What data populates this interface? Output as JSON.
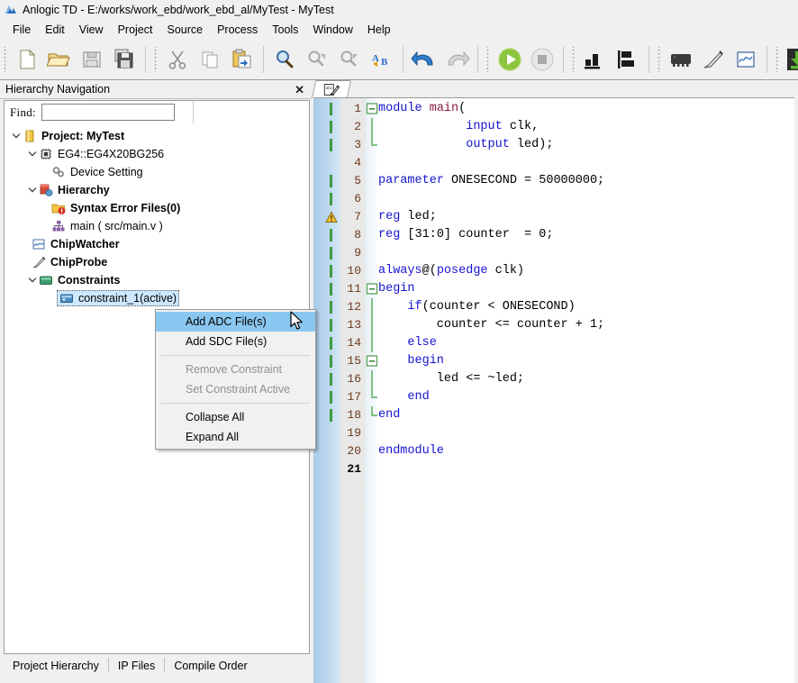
{
  "window": {
    "title": "Anlogic TD - E:/works/work_ebd/work_ebd_al/MyTest - MyTest",
    "app_icon": "anlogic-logo-icon"
  },
  "menubar": {
    "items": [
      {
        "label": "File",
        "name": "menu-file"
      },
      {
        "label": "Edit",
        "name": "menu-edit"
      },
      {
        "label": "View",
        "name": "menu-view"
      },
      {
        "label": "Project",
        "name": "menu-project"
      },
      {
        "label": "Source",
        "name": "menu-source"
      },
      {
        "label": "Process",
        "name": "menu-process"
      },
      {
        "label": "Tools",
        "name": "menu-tools"
      },
      {
        "label": "Window",
        "name": "menu-window"
      },
      {
        "label": "Help",
        "name": "menu-help"
      }
    ]
  },
  "toolbar": {
    "groups": [
      [
        "new-file-icon",
        "open-folder-icon",
        "save-icon",
        "save-all-icon"
      ],
      [
        "cut-icon",
        "copy-icon",
        "paste-icon"
      ],
      [
        "find-icon",
        "find-previous-icon",
        "find-next-icon",
        "replace-icon"
      ],
      [
        "undo-icon",
        "redo-icon"
      ],
      [
        "run-icon",
        "stop-icon"
      ],
      [
        "report-chart-icon",
        "layout-icon"
      ],
      [
        "device-chip-icon",
        "chipprobe-pen-icon",
        "chipwatcher-wave-icon"
      ],
      [
        "download-icon"
      ]
    ]
  },
  "hierarchy_panel": {
    "title": "Hierarchy Navigation",
    "close_icon": "close-icon",
    "find": {
      "label": "Find:",
      "value": "",
      "placeholder": ""
    },
    "tree": [
      {
        "label": "Project: MyTest",
        "icon": "project-folder-icon",
        "indent": 0,
        "twisty": "expanded",
        "bold": true,
        "selected": false
      },
      {
        "label": "EG4::EG4X20BG256",
        "icon": "device-chip-icon",
        "indent": 1,
        "twisty": "expanded",
        "bold": false,
        "selected": false
      },
      {
        "label": "Device Setting",
        "icon": "device-setting-icon",
        "indent": 2,
        "twisty": "none",
        "bold": false,
        "selected": false
      },
      {
        "label": "Hierarchy",
        "icon": "hierarchy-icon",
        "indent": 1,
        "twisty": "expanded",
        "bold": true,
        "selected": false
      },
      {
        "label": "Syntax Error Files(0)",
        "icon": "syntax-error-folder-icon",
        "indent": 2,
        "twisty": "none",
        "bold": true,
        "selected": false
      },
      {
        "label": "main ( src/main.v )",
        "icon": "module-tree-icon",
        "indent": 2,
        "twisty": "none",
        "bold": false,
        "selected": false
      },
      {
        "label": "ChipWatcher",
        "icon": "chipwatcher-wave-icon",
        "indent": 1,
        "twisty": "none",
        "bold": true,
        "selected": false
      },
      {
        "label": "ChipProbe",
        "icon": "chipprobe-pen-icon",
        "indent": 1,
        "twisty": "none",
        "bold": true,
        "selected": false
      },
      {
        "label": "Constraints",
        "icon": "constraints-icon",
        "indent": 1,
        "twisty": "expanded",
        "bold": true,
        "selected": false
      },
      {
        "label": "constraint_1(active)",
        "icon": "constraint-file-icon",
        "indent": 2,
        "twisty": "none",
        "bold": false,
        "selected": true
      }
    ],
    "bottom_tabs": [
      {
        "label": "Project Hierarchy",
        "active": true
      },
      {
        "label": "IP Files",
        "active": false
      },
      {
        "label": "Compile Order",
        "active": false
      }
    ]
  },
  "context_menu": {
    "items": [
      {
        "label": "Add ADC File(s)",
        "state": "highlighted"
      },
      {
        "label": "Add SDC File(s)",
        "state": "normal"
      },
      {
        "label": "__separator__",
        "state": "separator"
      },
      {
        "label": "Remove Constraint",
        "state": "disabled"
      },
      {
        "label": "Set Constraint Active",
        "state": "disabled"
      },
      {
        "label": "__separator__",
        "state": "separator"
      },
      {
        "label": "Collapse All",
        "state": "normal"
      },
      {
        "label": "Expand All",
        "state": "normal"
      }
    ]
  },
  "editor": {
    "tab_icon": "source-file-edit-icon",
    "current_line": 21,
    "lines": [
      {
        "num": "1",
        "changed": true,
        "warn": false,
        "fold": "open",
        "tokens": [
          {
            "t": "module",
            "c": "kw"
          },
          {
            "t": " ",
            "c": "pun"
          },
          {
            "t": "main",
            "c": "mod"
          },
          {
            "t": "(",
            "c": "pun"
          }
        ]
      },
      {
        "num": "2",
        "changed": true,
        "warn": false,
        "fold": "bar",
        "tokens": [
          {
            "t": "            ",
            "c": "pun"
          },
          {
            "t": "input",
            "c": "kw"
          },
          {
            "t": " clk,",
            "c": "pun"
          }
        ]
      },
      {
        "num": "3",
        "changed": true,
        "warn": false,
        "fold": "end",
        "tokens": [
          {
            "t": "            ",
            "c": "pun"
          },
          {
            "t": "output",
            "c": "kw"
          },
          {
            "t": " led);",
            "c": "pun"
          }
        ]
      },
      {
        "num": "4",
        "changed": false,
        "warn": false,
        "fold": "none",
        "tokens": []
      },
      {
        "num": "5",
        "changed": true,
        "warn": false,
        "fold": "none",
        "tokens": [
          {
            "t": "parameter",
            "c": "kw"
          },
          {
            "t": " ONESECOND = 50000000;",
            "c": "pun"
          }
        ]
      },
      {
        "num": "6",
        "changed": true,
        "warn": false,
        "fold": "none",
        "tokens": []
      },
      {
        "num": "7",
        "changed": false,
        "warn": true,
        "fold": "none",
        "tokens": [
          {
            "t": "reg",
            "c": "kw"
          },
          {
            "t": " led;",
            "c": "pun"
          }
        ]
      },
      {
        "num": "8",
        "changed": true,
        "warn": false,
        "fold": "none",
        "tokens": [
          {
            "t": "reg",
            "c": "kw"
          },
          {
            "t": " [31:0] counter  = 0;",
            "c": "pun"
          }
        ]
      },
      {
        "num": "9",
        "changed": true,
        "warn": false,
        "fold": "none",
        "tokens": []
      },
      {
        "num": "10",
        "changed": true,
        "warn": false,
        "fold": "none",
        "tokens": [
          {
            "t": "always",
            "c": "kw"
          },
          {
            "t": "@(",
            "c": "pun"
          },
          {
            "t": "posedge",
            "c": "kw"
          },
          {
            "t": " clk)",
            "c": "pun"
          }
        ]
      },
      {
        "num": "11",
        "changed": true,
        "warn": false,
        "fold": "open",
        "tokens": [
          {
            "t": "begin",
            "c": "kw"
          }
        ]
      },
      {
        "num": "12",
        "changed": true,
        "warn": false,
        "fold": "bar",
        "tokens": [
          {
            "t": "    ",
            "c": "pun"
          },
          {
            "t": "if",
            "c": "kw"
          },
          {
            "t": "(counter < ONESECOND)",
            "c": "pun"
          }
        ]
      },
      {
        "num": "13",
        "changed": true,
        "warn": false,
        "fold": "bar",
        "tokens": [
          {
            "t": "        counter <= counter + 1;",
            "c": "pun"
          }
        ]
      },
      {
        "num": "14",
        "changed": true,
        "warn": false,
        "fold": "bar",
        "tokens": [
          {
            "t": "    ",
            "c": "pun"
          },
          {
            "t": "else",
            "c": "kw"
          }
        ]
      },
      {
        "num": "15",
        "changed": true,
        "warn": false,
        "fold": "open2",
        "tokens": [
          {
            "t": "    ",
            "c": "pun"
          },
          {
            "t": "begin",
            "c": "kw"
          }
        ]
      },
      {
        "num": "16",
        "changed": true,
        "warn": false,
        "fold": "bar",
        "tokens": [
          {
            "t": "        led <= ~led;",
            "c": "pun"
          }
        ]
      },
      {
        "num": "17",
        "changed": true,
        "warn": false,
        "fold": "end",
        "tokens": [
          {
            "t": "    ",
            "c": "pun"
          },
          {
            "t": "end",
            "c": "kw"
          }
        ]
      },
      {
        "num": "18",
        "changed": true,
        "warn": false,
        "fold": "end",
        "tokens": [
          {
            "t": "end",
            "c": "kw"
          }
        ]
      },
      {
        "num": "19",
        "changed": false,
        "warn": false,
        "fold": "none",
        "tokens": []
      },
      {
        "num": "20",
        "changed": false,
        "warn": false,
        "fold": "none",
        "tokens": [
          {
            "t": "endmodule",
            "c": "kw"
          }
        ]
      },
      {
        "num": "21",
        "changed": false,
        "warn": false,
        "fold": "none",
        "tokens": []
      }
    ]
  },
  "colors": {
    "keyword": "#1414cf",
    "module_name": "#8b1a3a",
    "line_number": "#6b3a1e",
    "selection": "#cde8ff",
    "menu_highlight": "#8ac7f0",
    "change_bar": "#3f9b3f",
    "gutter_blue": "#bcd8ef"
  }
}
